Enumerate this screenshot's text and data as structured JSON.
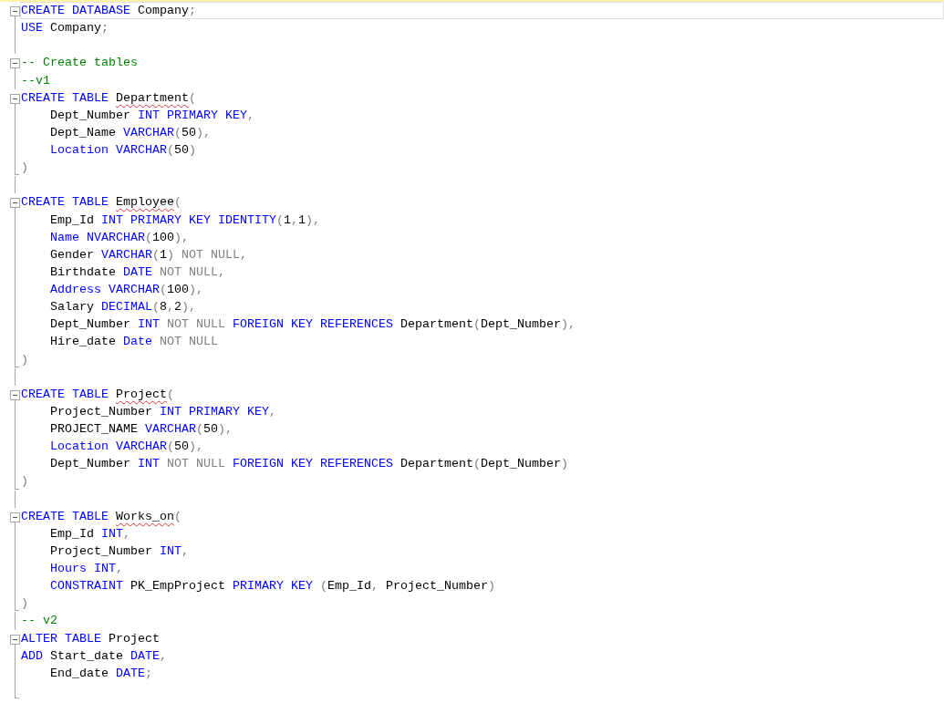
{
  "editor": {
    "lines": [
      {
        "kind": "start",
        "current": true,
        "tokens": [
          {
            "kind": "kw",
            "text": "CREATE DATABASE "
          },
          {
            "kind": "id",
            "text": "Company"
          },
          {
            "kind": "p",
            "text": ";"
          }
        ]
      },
      {
        "kind": "body",
        "current": false,
        "tokens": [
          {
            "kind": "kw",
            "text": "USE "
          },
          {
            "kind": "id",
            "text": "Company"
          },
          {
            "kind": "p",
            "text": ";"
          }
        ]
      },
      {
        "kind": "body",
        "current": false
      },
      {
        "kind": "start",
        "current": false,
        "tokens": [
          {
            "kind": "cm",
            "text": "-- Create tables"
          }
        ]
      },
      {
        "kind": "body",
        "current": false,
        "tokens": [
          {
            "kind": "cm",
            "text": "--v1"
          }
        ]
      },
      {
        "kind": "start",
        "current": false,
        "tokens": [
          {
            "kind": "kw",
            "text": "CREATE TABLE "
          },
          {
            "kind": "id",
            "text": "Department",
            "squiggle": true
          },
          {
            "kind": "p",
            "text": "("
          }
        ]
      },
      {
        "kind": "body",
        "current": false,
        "tokens": [
          {
            "kind": "id",
            "text": "    Dept_Number "
          },
          {
            "kind": "kw",
            "text": "INT PRIMARY KEY"
          },
          {
            "kind": "p",
            "text": ","
          }
        ]
      },
      {
        "kind": "body",
        "current": false,
        "tokens": [
          {
            "kind": "id",
            "text": "    Dept_Name "
          },
          {
            "kind": "kw",
            "text": "VARCHAR"
          },
          {
            "kind": "p",
            "text": "("
          },
          {
            "kind": "id",
            "text": "50"
          },
          {
            "kind": "p",
            "text": "),"
          }
        ]
      },
      {
        "kind": "body",
        "current": false,
        "tokens": [
          {
            "kind": "kw",
            "text": "    Location VARCHAR"
          },
          {
            "kind": "p",
            "text": "("
          },
          {
            "kind": "id",
            "text": "50"
          },
          {
            "kind": "p",
            "text": ")"
          }
        ]
      },
      {
        "kind": "end",
        "current": false,
        "tokens": [
          {
            "kind": "p",
            "text": ")"
          }
        ]
      },
      {
        "kind": "body",
        "current": false
      },
      {
        "kind": "start",
        "current": false,
        "tokens": [
          {
            "kind": "kw",
            "text": "CREATE TABLE "
          },
          {
            "kind": "id",
            "text": "Employee",
            "squiggle": true
          },
          {
            "kind": "p",
            "text": "("
          }
        ]
      },
      {
        "kind": "body",
        "current": false,
        "tokens": [
          {
            "kind": "id",
            "text": "    Emp_Id "
          },
          {
            "kind": "kw",
            "text": "INT PRIMARY KEY IDENTITY"
          },
          {
            "kind": "p",
            "text": "("
          },
          {
            "kind": "id",
            "text": "1"
          },
          {
            "kind": "p",
            "text": ","
          },
          {
            "kind": "id",
            "text": "1"
          },
          {
            "kind": "p",
            "text": "),"
          }
        ]
      },
      {
        "kind": "body",
        "current": false,
        "tokens": [
          {
            "kind": "kw",
            "text": "    Name NVARCHAR"
          },
          {
            "kind": "p",
            "text": "("
          },
          {
            "kind": "id",
            "text": "100"
          },
          {
            "kind": "p",
            "text": "),"
          }
        ]
      },
      {
        "kind": "body",
        "current": false,
        "tokens": [
          {
            "kind": "id",
            "text": "    Gender "
          },
          {
            "kind": "kw",
            "text": "VARCHAR"
          },
          {
            "kind": "p",
            "text": "("
          },
          {
            "kind": "id",
            "text": "1"
          },
          {
            "kind": "p",
            "text": ") NOT NULL,"
          }
        ]
      },
      {
        "kind": "body",
        "current": false,
        "tokens": [
          {
            "kind": "id",
            "text": "    Birthdate "
          },
          {
            "kind": "kw",
            "text": "DATE "
          },
          {
            "kind": "p",
            "text": "NOT NULL,"
          }
        ]
      },
      {
        "kind": "body",
        "current": false,
        "tokens": [
          {
            "kind": "kw",
            "text": "    Address VARCHAR"
          },
          {
            "kind": "p",
            "text": "("
          },
          {
            "kind": "id",
            "text": "100"
          },
          {
            "kind": "p",
            "text": "),"
          }
        ]
      },
      {
        "kind": "body",
        "current": false,
        "tokens": [
          {
            "kind": "id",
            "text": "    Salary "
          },
          {
            "kind": "kw",
            "text": "DECIMAL"
          },
          {
            "kind": "p",
            "text": "("
          },
          {
            "kind": "id",
            "text": "8"
          },
          {
            "kind": "p",
            "text": ","
          },
          {
            "kind": "id",
            "text": "2"
          },
          {
            "kind": "p",
            "text": "),"
          }
        ]
      },
      {
        "kind": "body",
        "current": false,
        "tokens": [
          {
            "kind": "id",
            "text": "    Dept_Number "
          },
          {
            "kind": "kw",
            "text": "INT "
          },
          {
            "kind": "p",
            "text": "NOT NULL "
          },
          {
            "kind": "kw",
            "text": "FOREIGN KEY REFERENCES "
          },
          {
            "kind": "id",
            "text": "Department"
          },
          {
            "kind": "p",
            "text": "("
          },
          {
            "kind": "id",
            "text": "Dept_Number"
          },
          {
            "kind": "p",
            "text": "),"
          }
        ]
      },
      {
        "kind": "body",
        "current": false,
        "tokens": [
          {
            "kind": "id",
            "text": "    Hire_date "
          },
          {
            "kind": "kw",
            "text": "Date "
          },
          {
            "kind": "p",
            "text": "NOT NULL"
          }
        ]
      },
      {
        "kind": "end",
        "current": false,
        "tokens": [
          {
            "kind": "p",
            "text": ")"
          }
        ]
      },
      {
        "kind": "body",
        "current": false
      },
      {
        "kind": "start",
        "current": false,
        "tokens": [
          {
            "kind": "kw",
            "text": "CREATE TABLE "
          },
          {
            "kind": "id",
            "text": "Project",
            "squiggle": true
          },
          {
            "kind": "p",
            "text": "("
          }
        ]
      },
      {
        "kind": "body",
        "current": false,
        "tokens": [
          {
            "kind": "id",
            "text": "    Project_Number "
          },
          {
            "kind": "kw",
            "text": "INT PRIMARY KEY"
          },
          {
            "kind": "p",
            "text": ","
          }
        ]
      },
      {
        "kind": "body",
        "current": false,
        "tokens": [
          {
            "kind": "id",
            "text": "    PROJECT_NAME "
          },
          {
            "kind": "kw",
            "text": "VARCHAR"
          },
          {
            "kind": "p",
            "text": "("
          },
          {
            "kind": "id",
            "text": "50"
          },
          {
            "kind": "p",
            "text": "),"
          }
        ]
      },
      {
        "kind": "body",
        "current": false,
        "tokens": [
          {
            "kind": "kw",
            "text": "    Location VARCHAR"
          },
          {
            "kind": "p",
            "text": "("
          },
          {
            "kind": "id",
            "text": "50"
          },
          {
            "kind": "p",
            "text": "),"
          }
        ]
      },
      {
        "kind": "body",
        "current": false,
        "tokens": [
          {
            "kind": "id",
            "text": "    Dept_Number "
          },
          {
            "kind": "kw",
            "text": "INT "
          },
          {
            "kind": "p",
            "text": "NOT NULL "
          },
          {
            "kind": "kw",
            "text": "FOREIGN KEY REFERENCES "
          },
          {
            "kind": "id",
            "text": "Department"
          },
          {
            "kind": "p",
            "text": "("
          },
          {
            "kind": "id",
            "text": "Dept_Number"
          },
          {
            "kind": "p",
            "text": ")"
          }
        ]
      },
      {
        "kind": "end",
        "current": false,
        "tokens": [
          {
            "kind": "p",
            "text": ")"
          }
        ]
      },
      {
        "kind": "body",
        "current": false
      },
      {
        "kind": "start",
        "current": false,
        "tokens": [
          {
            "kind": "kw",
            "text": "CREATE TABLE "
          },
          {
            "kind": "id",
            "text": "Works_on",
            "squiggle": true
          },
          {
            "kind": "p",
            "text": "("
          }
        ]
      },
      {
        "kind": "body",
        "current": false,
        "tokens": [
          {
            "kind": "id",
            "text": "    Emp_Id "
          },
          {
            "kind": "kw",
            "text": "INT"
          },
          {
            "kind": "p",
            "text": ","
          }
        ]
      },
      {
        "kind": "body",
        "current": false,
        "tokens": [
          {
            "kind": "id",
            "text": "    Project_Number "
          },
          {
            "kind": "kw",
            "text": "INT"
          },
          {
            "kind": "p",
            "text": ","
          }
        ]
      },
      {
        "kind": "body",
        "current": false,
        "tokens": [
          {
            "kind": "kw",
            "text": "    Hours INT"
          },
          {
            "kind": "p",
            "text": ","
          }
        ]
      },
      {
        "kind": "body",
        "current": false,
        "tokens": [
          {
            "kind": "kw",
            "text": "    CONSTRAINT "
          },
          {
            "kind": "id",
            "text": "PK_EmpProject "
          },
          {
            "kind": "kw",
            "text": "PRIMARY KEY "
          },
          {
            "kind": "p",
            "text": "("
          },
          {
            "kind": "id",
            "text": "Emp_Id"
          },
          {
            "kind": "p",
            "text": ", "
          },
          {
            "kind": "id",
            "text": "Project_Number"
          },
          {
            "kind": "p",
            "text": ")"
          }
        ]
      },
      {
        "kind": "end",
        "current": false,
        "tokens": [
          {
            "kind": "p",
            "text": ")"
          }
        ]
      },
      {
        "kind": "body",
        "current": false,
        "tokens": [
          {
            "kind": "cm",
            "text": "-- v2"
          }
        ]
      },
      {
        "kind": "start",
        "current": false,
        "tokens": [
          {
            "kind": "kw",
            "text": "ALTER TABLE "
          },
          {
            "kind": "id",
            "text": "Project"
          }
        ]
      },
      {
        "kind": "body",
        "current": false,
        "tokens": [
          {
            "kind": "kw",
            "text": "ADD "
          },
          {
            "kind": "id",
            "text": "Start_date "
          },
          {
            "kind": "kw",
            "text": "DATE"
          },
          {
            "kind": "p",
            "text": ","
          }
        ]
      },
      {
        "kind": "body",
        "current": false,
        "tokens": [
          {
            "kind": "id",
            "text": "    End_date "
          },
          {
            "kind": "kw",
            "text": "DATE"
          },
          {
            "kind": "p",
            "text": ";"
          }
        ]
      },
      {
        "kind": "end",
        "current": false
      }
    ]
  }
}
